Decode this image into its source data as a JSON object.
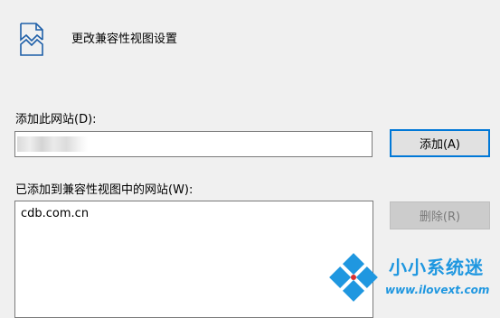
{
  "dialog": {
    "title": "更改兼容性视图设置",
    "add_site_label": "添加此网站(D):",
    "site_input_value": "",
    "add_button": "添加(A)",
    "list_label": "已添加到兼容性视图中的网站(W):",
    "sites": [
      "cdb.com.cn"
    ],
    "remove_button": "删除(R)"
  },
  "watermark": {
    "name": "小小系统迷",
    "url": "www.ilovext.com"
  },
  "colors": {
    "accent": "#0078d7",
    "watermark": "#1f97e0"
  },
  "icons": {
    "title": "broken-page-icon",
    "watermark_logo": "windows-logo-icon"
  }
}
